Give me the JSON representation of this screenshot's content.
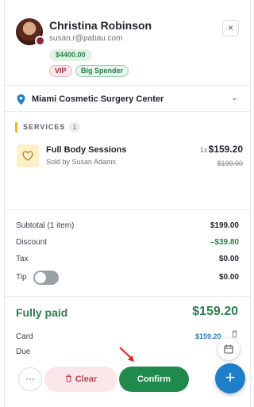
{
  "client": {
    "name": "Christina Robinson",
    "email": "susan.r@pabau.com",
    "balance": "$4400.00",
    "tags": [
      "VIP",
      "Big Spender"
    ]
  },
  "header": {
    "close_label": "×"
  },
  "location": {
    "name": "Miami Cosmetic Surgery Center",
    "chevron": "⌄"
  },
  "services": {
    "label": "SERVICES",
    "count": "1",
    "items": [
      {
        "title": "Full Body Sessions",
        "sold_by": "Sold by Susan Adams",
        "qty": "1x",
        "price": "$159.20",
        "original_price": "$199.00"
      }
    ]
  },
  "summary": {
    "subtotal_label": "Subtotal (1 item)",
    "subtotal_value": "$199.00",
    "discount_label": "Discount",
    "discount_value": "–$39.80",
    "tax_label": "Tax",
    "tax_value": "$0.00",
    "tip_label": "Tip",
    "tip_value": "$0.00",
    "tip_enabled": false
  },
  "payment": {
    "status_label": "Fully paid",
    "status_value": "$159.20",
    "card_label": "Card",
    "card_value": "$159.20",
    "due_label": "Due"
  },
  "footer": {
    "more_label": "···",
    "clear_label": "Clear",
    "confirm_label": "Confirm",
    "fab_label": "+"
  },
  "colors": {
    "green": "#1f8a4c",
    "blue": "#1e7ec8",
    "clear_bg": "#fbe7ea",
    "services_accent": "#f0b429"
  }
}
